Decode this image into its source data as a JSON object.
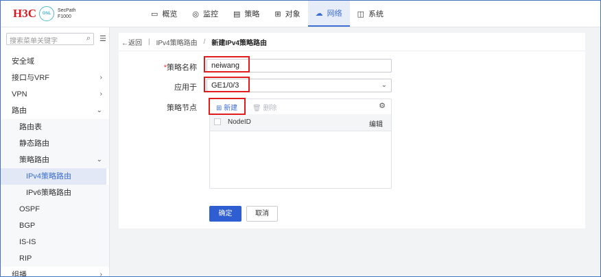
{
  "header": {
    "logo_text": "H3C",
    "logo_badge": "ONL",
    "product_line1": "SecPath",
    "product_line2": "F1000",
    "nav": [
      {
        "label": "概览",
        "icon": "monitor-icon"
      },
      {
        "label": "监控",
        "icon": "location-pin-icon"
      },
      {
        "label": "策略",
        "icon": "clipboard-icon"
      },
      {
        "label": "对象",
        "icon": "grid-icon"
      },
      {
        "label": "网络",
        "icon": "cloud-network-icon",
        "active": true
      },
      {
        "label": "系统",
        "icon": "system-icon"
      }
    ]
  },
  "sidebar": {
    "search_placeholder": "搜索菜单关键字",
    "items": [
      {
        "label": "安全域"
      },
      {
        "label": "接口与VRF",
        "arrow": "›"
      },
      {
        "label": "VPN",
        "arrow": "›"
      },
      {
        "label": "路由",
        "arrow": "⌄"
      },
      {
        "label": "路由表"
      },
      {
        "label": "静态路由"
      },
      {
        "label": "策略路由",
        "arrow": "⌄"
      },
      {
        "label": "IPv4策略路由"
      },
      {
        "label": "IPv6策略路由"
      },
      {
        "label": "OSPF"
      },
      {
        "label": "BGP"
      },
      {
        "label": "IS-IS"
      },
      {
        "label": "RIP"
      },
      {
        "label": "组播",
        "arrow": "›"
      }
    ]
  },
  "breadcrumb": {
    "back": "返回",
    "parent": "IPv4策略路由",
    "separator": "/",
    "current": "新建IPv4策略路由"
  },
  "form": {
    "name_required_mark": "*",
    "name_label": "策略名称",
    "name_value": "neiwang",
    "apply_label": "应用于",
    "apply_value": "GE1/0/3",
    "node_label": "策略节点",
    "new_label": "新建",
    "delete_label": "删除",
    "col_nodeid": "NodeID",
    "col_edit": "编辑",
    "ok_label": "确定",
    "cancel_label": "取消"
  },
  "colors": {
    "accent": "#3c6fd1",
    "primary_button": "#2f5ed3",
    "highlight_box": "#e11b1b",
    "logo_red": "#d71a20"
  }
}
